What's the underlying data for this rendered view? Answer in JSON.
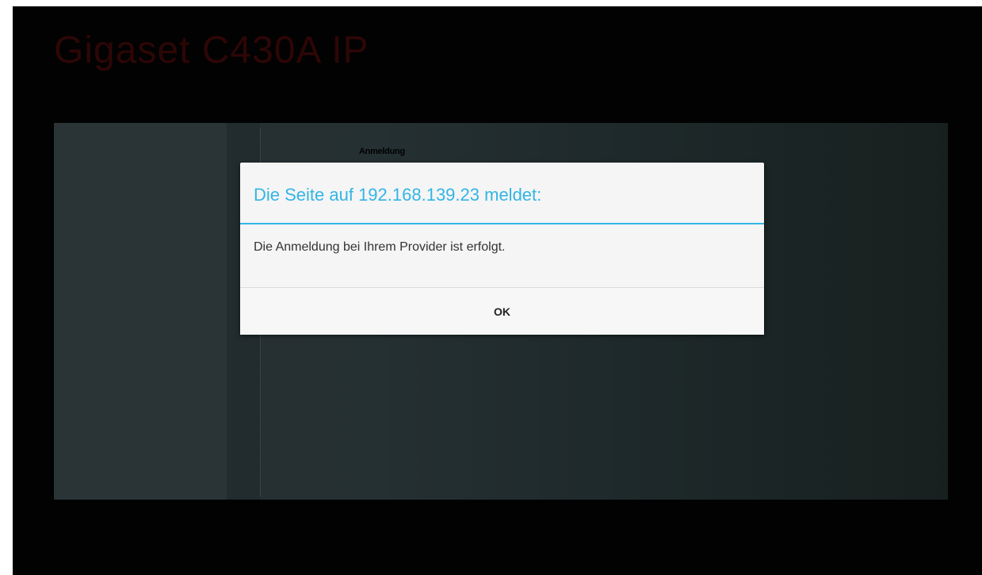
{
  "app": {
    "brand_title": "Gigaset C430A IP"
  },
  "page": {
    "heading": "Anmeldung"
  },
  "dialog": {
    "title": "Die Seite auf 192.168.139.23 meldet:",
    "message": "Die Anmeldung bei Ihrem Provider ist erfolgt.",
    "ok_label": "OK"
  },
  "colors": {
    "accent": "#33b5e5",
    "background": "#020202",
    "brand_title": "#2e0606"
  }
}
